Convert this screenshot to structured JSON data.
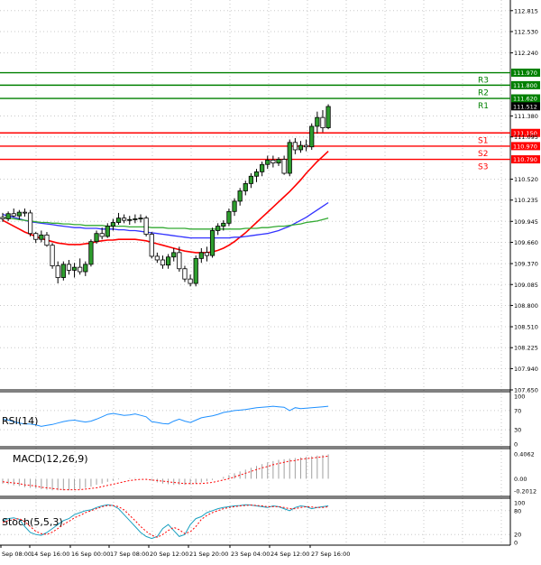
{
  "chart_data": {
    "type": "candlestick",
    "price_axis": {
      "ticks": [
        "112.815",
        "112.530",
        "112.240",
        "111.380",
        "111.095",
        "110.520",
        "110.235",
        "109.945",
        "109.660",
        "109.370",
        "109.085",
        "108.800",
        "108.510",
        "108.225",
        "107.940",
        "107.650"
      ],
      "ylim": [
        107.65,
        112.96
      ],
      "last_price": "111.512"
    },
    "levels": [
      {
        "name": "R3",
        "value": 111.97,
        "label": "111.970",
        "color": "#008000"
      },
      {
        "name": "R2",
        "value": 111.8,
        "label": "111.800",
        "color": "#008000"
      },
      {
        "name": "R1",
        "value": 111.62,
        "label": "111.620",
        "color": "#008000"
      },
      {
        "name": "S1",
        "value": 111.15,
        "label": "111.150",
        "color": "#ff0000"
      },
      {
        "name": "S2",
        "value": 110.97,
        "label": "110.970",
        "color": "#ff0000"
      },
      {
        "name": "S3",
        "value": 110.79,
        "label": "110.790",
        "color": "#ff0000"
      }
    ],
    "candles": [
      {
        "o": 110.0,
        "h": 110.06,
        "l": 109.94,
        "c": 109.98
      },
      {
        "o": 109.98,
        "h": 110.08,
        "l": 109.95,
        "c": 110.05
      },
      {
        "o": 110.05,
        "h": 110.12,
        "l": 110.0,
        "c": 110.02
      },
      {
        "o": 110.02,
        "h": 110.1,
        "l": 109.97,
        "c": 110.07
      },
      {
        "o": 110.07,
        "h": 110.12,
        "l": 110.01,
        "c": 110.06
      },
      {
        "o": 110.06,
        "h": 110.1,
        "l": 109.74,
        "c": 109.78
      },
      {
        "o": 109.78,
        "h": 109.8,
        "l": 109.65,
        "c": 109.7
      },
      {
        "o": 109.7,
        "h": 109.82,
        "l": 109.66,
        "c": 109.76
      },
      {
        "o": 109.76,
        "h": 109.8,
        "l": 109.6,
        "c": 109.62
      },
      {
        "o": 109.62,
        "h": 109.65,
        "l": 109.3,
        "c": 109.34
      },
      {
        "o": 109.34,
        "h": 109.4,
        "l": 109.1,
        "c": 109.18
      },
      {
        "o": 109.18,
        "h": 109.4,
        "l": 109.14,
        "c": 109.36
      },
      {
        "o": 109.36,
        "h": 109.42,
        "l": 109.22,
        "c": 109.28
      },
      {
        "o": 109.28,
        "h": 109.38,
        "l": 109.18,
        "c": 109.32
      },
      {
        "o": 109.32,
        "h": 109.44,
        "l": 109.22,
        "c": 109.26
      },
      {
        "o": 109.26,
        "h": 109.4,
        "l": 109.2,
        "c": 109.36
      },
      {
        "o": 109.36,
        "h": 109.7,
        "l": 109.33,
        "c": 109.67
      },
      {
        "o": 109.67,
        "h": 109.82,
        "l": 109.64,
        "c": 109.78
      },
      {
        "o": 109.78,
        "h": 109.86,
        "l": 109.7,
        "c": 109.74
      },
      {
        "o": 109.74,
        "h": 109.92,
        "l": 109.72,
        "c": 109.88
      },
      {
        "o": 109.88,
        "h": 109.98,
        "l": 109.82,
        "c": 109.93
      },
      {
        "o": 109.93,
        "h": 110.06,
        "l": 109.9,
        "c": 109.99
      },
      {
        "o": 109.99,
        "h": 110.04,
        "l": 109.92,
        "c": 109.96
      },
      {
        "o": 109.96,
        "h": 110.02,
        "l": 109.9,
        "c": 109.97
      },
      {
        "o": 109.97,
        "h": 110.04,
        "l": 109.92,
        "c": 109.98
      },
      {
        "o": 109.98,
        "h": 110.04,
        "l": 109.93,
        "c": 109.99
      },
      {
        "o": 109.99,
        "h": 110.02,
        "l": 109.74,
        "c": 109.77
      },
      {
        "o": 109.77,
        "h": 109.8,
        "l": 109.44,
        "c": 109.47
      },
      {
        "o": 109.47,
        "h": 109.52,
        "l": 109.38,
        "c": 109.42
      },
      {
        "o": 109.42,
        "h": 109.48,
        "l": 109.3,
        "c": 109.35
      },
      {
        "o": 109.35,
        "h": 109.5,
        "l": 109.3,
        "c": 109.46
      },
      {
        "o": 109.46,
        "h": 109.58,
        "l": 109.4,
        "c": 109.52
      },
      {
        "o": 109.52,
        "h": 109.6,
        "l": 109.26,
        "c": 109.3
      },
      {
        "o": 109.3,
        "h": 109.34,
        "l": 109.12,
        "c": 109.16
      },
      {
        "o": 109.16,
        "h": 109.22,
        "l": 109.06,
        "c": 109.1
      },
      {
        "o": 109.1,
        "h": 109.48,
        "l": 109.06,
        "c": 109.44
      },
      {
        "o": 109.44,
        "h": 109.58,
        "l": 109.38,
        "c": 109.52
      },
      {
        "o": 109.52,
        "h": 109.6,
        "l": 109.4,
        "c": 109.48
      },
      {
        "o": 109.48,
        "h": 109.86,
        "l": 109.45,
        "c": 109.82
      },
      {
        "o": 109.82,
        "h": 109.92,
        "l": 109.76,
        "c": 109.88
      },
      {
        "o": 109.88,
        "h": 109.96,
        "l": 109.82,
        "c": 109.92
      },
      {
        "o": 109.92,
        "h": 110.12,
        "l": 109.88,
        "c": 110.08
      },
      {
        "o": 110.08,
        "h": 110.26,
        "l": 110.02,
        "c": 110.22
      },
      {
        "o": 110.22,
        "h": 110.4,
        "l": 110.16,
        "c": 110.36
      },
      {
        "o": 110.36,
        "h": 110.5,
        "l": 110.3,
        "c": 110.46
      },
      {
        "o": 110.46,
        "h": 110.6,
        "l": 110.4,
        "c": 110.56
      },
      {
        "o": 110.56,
        "h": 110.66,
        "l": 110.48,
        "c": 110.62
      },
      {
        "o": 110.62,
        "h": 110.76,
        "l": 110.56,
        "c": 110.72
      },
      {
        "o": 110.72,
        "h": 110.84,
        "l": 110.66,
        "c": 110.78
      },
      {
        "o": 110.78,
        "h": 110.84,
        "l": 110.68,
        "c": 110.74
      },
      {
        "o": 110.74,
        "h": 110.82,
        "l": 110.7,
        "c": 110.79
      },
      {
        "o": 110.79,
        "h": 110.84,
        "l": 110.58,
        "c": 110.6
      },
      {
        "o": 110.6,
        "h": 111.06,
        "l": 110.56,
        "c": 111.02
      },
      {
        "o": 111.02,
        "h": 111.08,
        "l": 110.86,
        "c": 110.92
      },
      {
        "o": 110.92,
        "h": 111.04,
        "l": 110.88,
        "c": 110.98
      },
      {
        "o": 110.98,
        "h": 111.06,
        "l": 110.9,
        "c": 110.96
      },
      {
        "o": 110.96,
        "h": 111.28,
        "l": 110.92,
        "c": 111.24
      },
      {
        "o": 111.24,
        "h": 111.44,
        "l": 111.14,
        "c": 111.36
      },
      {
        "o": 111.36,
        "h": 111.46,
        "l": 111.16,
        "c": 111.22
      },
      {
        "o": 111.22,
        "h": 111.54,
        "l": 111.2,
        "c": 111.51
      }
    ],
    "moving_averages": [
      {
        "color": "#ff0000",
        "values": [
          109.96,
          109.92,
          109.88,
          109.84,
          109.8,
          109.77,
          109.74,
          109.71,
          109.69,
          109.67,
          109.65,
          109.64,
          109.63,
          109.63,
          109.63,
          109.64,
          109.65,
          109.67,
          109.68,
          109.69,
          109.69,
          109.7,
          109.7,
          109.7,
          109.7,
          109.69,
          109.68,
          109.66,
          109.64,
          109.62,
          109.6,
          109.58,
          109.56,
          109.54,
          109.53,
          109.52,
          109.52,
          109.52,
          109.53,
          109.55,
          109.58,
          109.62,
          109.67,
          109.73,
          109.79,
          109.86,
          109.93,
          110.0,
          110.07,
          110.14,
          110.21,
          110.28,
          110.35,
          110.43,
          110.51,
          110.6,
          110.68,
          110.76,
          110.83,
          110.9
        ]
      },
      {
        "color": "#3333ff",
        "values": [
          110.04,
          110.02,
          110.0,
          109.98,
          109.96,
          109.94,
          109.93,
          109.92,
          109.91,
          109.9,
          109.89,
          109.88,
          109.87,
          109.86,
          109.86,
          109.85,
          109.85,
          109.85,
          109.84,
          109.84,
          109.84,
          109.83,
          109.83,
          109.82,
          109.82,
          109.81,
          109.8,
          109.79,
          109.78,
          109.77,
          109.76,
          109.75,
          109.74,
          109.73,
          109.72,
          109.72,
          109.72,
          109.72,
          109.72,
          109.72,
          109.72,
          109.72,
          109.73,
          109.73,
          109.74,
          109.75,
          109.76,
          109.77,
          109.78,
          109.8,
          109.82,
          109.85,
          109.88,
          109.92,
          109.96,
          110.0,
          110.05,
          110.1,
          110.15,
          110.2
        ]
      },
      {
        "color": "#33aa33",
        "values": [
          110.0,
          109.99,
          109.98,
          109.97,
          109.96,
          109.95,
          109.94,
          109.93,
          109.93,
          109.92,
          109.92,
          109.91,
          109.91,
          109.9,
          109.9,
          109.89,
          109.89,
          109.89,
          109.89,
          109.88,
          109.88,
          109.88,
          109.88,
          109.87,
          109.87,
          109.87,
          109.87,
          109.86,
          109.86,
          109.86,
          109.85,
          109.85,
          109.85,
          109.85,
          109.84,
          109.84,
          109.84,
          109.84,
          109.84,
          109.84,
          109.84,
          109.84,
          109.84,
          109.84,
          109.85,
          109.85,
          109.85,
          109.86,
          109.86,
          109.87,
          109.88,
          109.88,
          109.89,
          109.9,
          109.91,
          109.93,
          109.94,
          109.95,
          109.97,
          109.99
        ]
      }
    ],
    "rsi": {
      "label": "RSI(14)",
      "ticks": [
        "100",
        "70",
        "30",
        "0"
      ],
      "levels": [
        100,
        70,
        30,
        0
      ],
      "values": [
        52,
        50,
        47,
        44,
        42,
        42,
        40,
        37,
        39,
        41,
        44,
        47,
        49,
        50,
        48,
        46,
        48,
        52,
        57,
        62,
        64,
        62,
        60,
        61,
        63,
        60,
        57,
        47,
        45,
        43,
        42,
        48,
        52,
        48,
        45,
        50,
        55,
        57,
        59,
        62,
        66,
        68,
        70,
        71,
        72,
        74,
        76,
        77,
        78,
        79,
        78,
        77,
        70,
        76,
        74,
        75,
        76,
        77,
        78,
        79
      ]
    },
    "macd": {
      "label": "MACD(12,26,9)",
      "ticks": [
        "0.4062",
        "0.00",
        "-0.2012"
      ],
      "values": [
        -0.08,
        -0.09,
        -0.11,
        -0.12,
        -0.14,
        -0.15,
        -0.16,
        -0.17,
        -0.18,
        -0.19,
        -0.19,
        -0.19,
        -0.19,
        -0.18,
        -0.17,
        -0.15,
        -0.13,
        -0.1,
        -0.08,
        -0.05,
        -0.03,
        -0.01,
        0.0,
        0.01,
        0.01,
        0.0,
        -0.01,
        -0.03,
        -0.06,
        -0.08,
        -0.09,
        -0.1,
        -0.1,
        -0.1,
        -0.09,
        -0.08,
        -0.06,
        -0.04,
        -0.02,
        0.0,
        0.03,
        0.06,
        0.09,
        0.12,
        0.15,
        0.18,
        0.21,
        0.24,
        0.27,
        0.29,
        0.31,
        0.32,
        0.33,
        0.34,
        0.35,
        0.36,
        0.37,
        0.38,
        0.39,
        0.4
      ],
      "signal": [
        -0.05,
        -0.06,
        -0.07,
        -0.08,
        -0.1,
        -0.11,
        -0.12,
        -0.14,
        -0.15,
        -0.16,
        -0.17,
        -0.18,
        -0.18,
        -0.18,
        -0.18,
        -0.17,
        -0.16,
        -0.15,
        -0.13,
        -0.11,
        -0.09,
        -0.07,
        -0.05,
        -0.03,
        -0.02,
        -0.01,
        -0.01,
        -0.02,
        -0.03,
        -0.04,
        -0.05,
        -0.06,
        -0.07,
        -0.08,
        -0.08,
        -0.08,
        -0.08,
        -0.07,
        -0.06,
        -0.04,
        -0.02,
        0.0,
        0.03,
        0.06,
        0.09,
        0.12,
        0.15,
        0.18,
        0.2,
        0.23,
        0.25,
        0.27,
        0.29,
        0.3,
        0.32,
        0.33,
        0.34,
        0.35,
        0.36,
        0.37
      ]
    },
    "stoch": {
      "label": "Stoch(5,5,3)",
      "ticks": [
        "100",
        "80",
        "20",
        "0"
      ],
      "levels": [
        100,
        80,
        20,
        0
      ],
      "k": [
        55,
        60,
        62,
        58,
        40,
        25,
        20,
        18,
        25,
        35,
        45,
        55,
        60,
        70,
        75,
        80,
        82,
        88,
        92,
        95,
        93,
        85,
        70,
        55,
        40,
        25,
        15,
        10,
        15,
        35,
        45,
        30,
        15,
        20,
        45,
        60,
        65,
        75,
        80,
        85,
        88,
        90,
        92,
        93,
        95,
        94,
        92,
        90,
        88,
        92,
        90,
        85,
        80,
        88,
        92,
        90,
        85,
        88,
        90,
        92
      ],
      "d": [
        50,
        55,
        58,
        60,
        52,
        40,
        28,
        22,
        20,
        26,
        35,
        45,
        53,
        62,
        68,
        75,
        80,
        85,
        90,
        93,
        93,
        90,
        82,
        68,
        55,
        40,
        28,
        18,
        13,
        20,
        30,
        38,
        32,
        22,
        27,
        40,
        58,
        68,
        75,
        80,
        85,
        88,
        90,
        92,
        93,
        94,
        93,
        92,
        90,
        90,
        90,
        88,
        85,
        85,
        88,
        90,
        89,
        88,
        88,
        90
      ]
    },
    "time_labels": [
      "Sep 08:00",
      "14 Sep 16:00",
      "16 Sep 00:00",
      "17 Sep 08:00",
      "20 Sep 12:00",
      "21 Sep 20:00",
      "23 Sep 04:00",
      "24 Sep 12:00",
      "27 Sep 16:00"
    ]
  }
}
